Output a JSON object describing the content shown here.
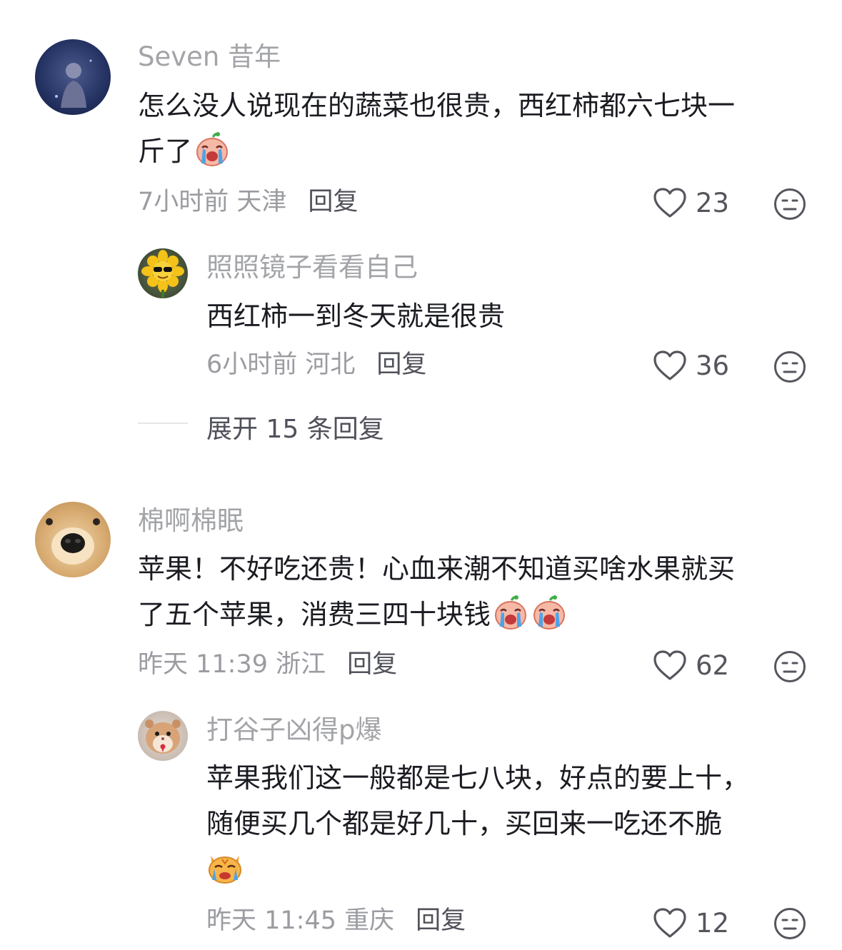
{
  "comments": [
    {
      "username": "Seven 昔年",
      "text_line1": "怎么没人说现在的蔬菜也很贵，西红柿都六七块一",
      "text_line2": "斤了",
      "time": "7小时前 天津",
      "reply_label": "回复",
      "likes": "23",
      "emojis": [
        "crying-tomato-emoji"
      ]
    },
    {
      "username": "棉啊棉眠",
      "text_line1": "苹果！不好吃还贵！心血来潮不知道买啥水果就买",
      "text_line2": "了五个苹果，消费三四十块钱",
      "time": "昨天 11:39 浙江",
      "reply_label": "回复",
      "likes": "62",
      "emojis": [
        "crying-tomato-emoji",
        "crying-tomato-emoji"
      ]
    }
  ],
  "replies": [
    {
      "username": "照照镜子看看自己",
      "text_line1": "西红柿一到冬天就是很贵",
      "time": "6小时前 河北",
      "reply_label": "回复",
      "likes": "36"
    },
    {
      "username": "打谷子凶得p爆",
      "text_line1": "苹果我们这一般都是七八块，好点的要上十，",
      "text_line2": "随便买几个都是好几十，买回来一吃还不脆",
      "time": "昨天 11:45 重庆",
      "reply_label": "回复",
      "likes": "12",
      "emojis": [
        "crying-cat-emoji"
      ]
    }
  ],
  "expand": {
    "label": "展开 15 条回复"
  },
  "icons": {
    "like": "heart-outline-icon",
    "dislike": "meh-face-icon"
  },
  "colors": {
    "username": "#a3a4a8",
    "text": "#1b1c22",
    "meta": "#9b9ca1"
  }
}
